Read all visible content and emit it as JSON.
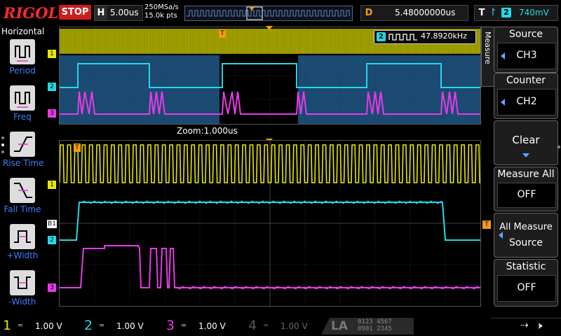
{
  "topbar": {
    "logo": "RIGOL",
    "run_status": "STOP",
    "horizontal_label": "H",
    "timebase": "5.00us",
    "sample_rate": "250MSa/s",
    "memory_depth": "15.0k pts",
    "delay_label": "D",
    "delay": "5.48000000us",
    "trigger_label": "T",
    "trigger_source": "2",
    "trigger_level": "740mV"
  },
  "left_panel": {
    "title": "Horizontal",
    "items": [
      {
        "label": "Period",
        "icon": "period-icon"
      },
      {
        "label": "Freq",
        "icon": "frequency-icon"
      },
      {
        "label": "Rise Time",
        "icon": "rise-time-icon"
      },
      {
        "label": "Fall Time",
        "icon": "fall-time-icon"
      },
      {
        "label": "+Width",
        "icon": "positive-width-icon"
      },
      {
        "label": "-Width",
        "icon": "negative-width-icon"
      }
    ]
  },
  "main_window": {
    "measurement_channel": "2",
    "measurement_value": "47.8920kHz",
    "zoom_label": "Zoom:1.000us",
    "channel_markers": [
      "1",
      "2",
      "3"
    ],
    "bus_marker": "B1",
    "trigger_marker": "T"
  },
  "right_menu": {
    "tab_label": "Measure",
    "source": {
      "title": "Source",
      "value": "CH3"
    },
    "counter": {
      "title": "Counter",
      "value": "CH2"
    },
    "clear": {
      "title": "Clear"
    },
    "measure_all": {
      "title": "Measure All",
      "value": "OFF"
    },
    "all_measure_source": {
      "line1": "All Measure",
      "line2": "Source"
    },
    "statistic": {
      "title": "Statistic",
      "value": "OFF"
    }
  },
  "channels": [
    {
      "num": "1",
      "scale": "1.00 V",
      "color": "#e8e800"
    },
    {
      "num": "2",
      "scale": "1.00 V",
      "color": "#23d9e8"
    },
    {
      "num": "3",
      "scale": "1.00 V",
      "color": "#e83ae8"
    },
    {
      "num": "4",
      "scale": "1.00 V",
      "color": "#4f7fff"
    }
  ],
  "la": {
    "label": "LA",
    "row1": "0123  4567",
    "row2": "8901  2345"
  },
  "colors": {
    "ch1": "#e8e800",
    "ch2": "#23d9e8",
    "ch3": "#e83ae8",
    "accent_orange": "#f39c12",
    "stop_red": "#cc1d1d",
    "menu_blue": "#3d7fff"
  }
}
